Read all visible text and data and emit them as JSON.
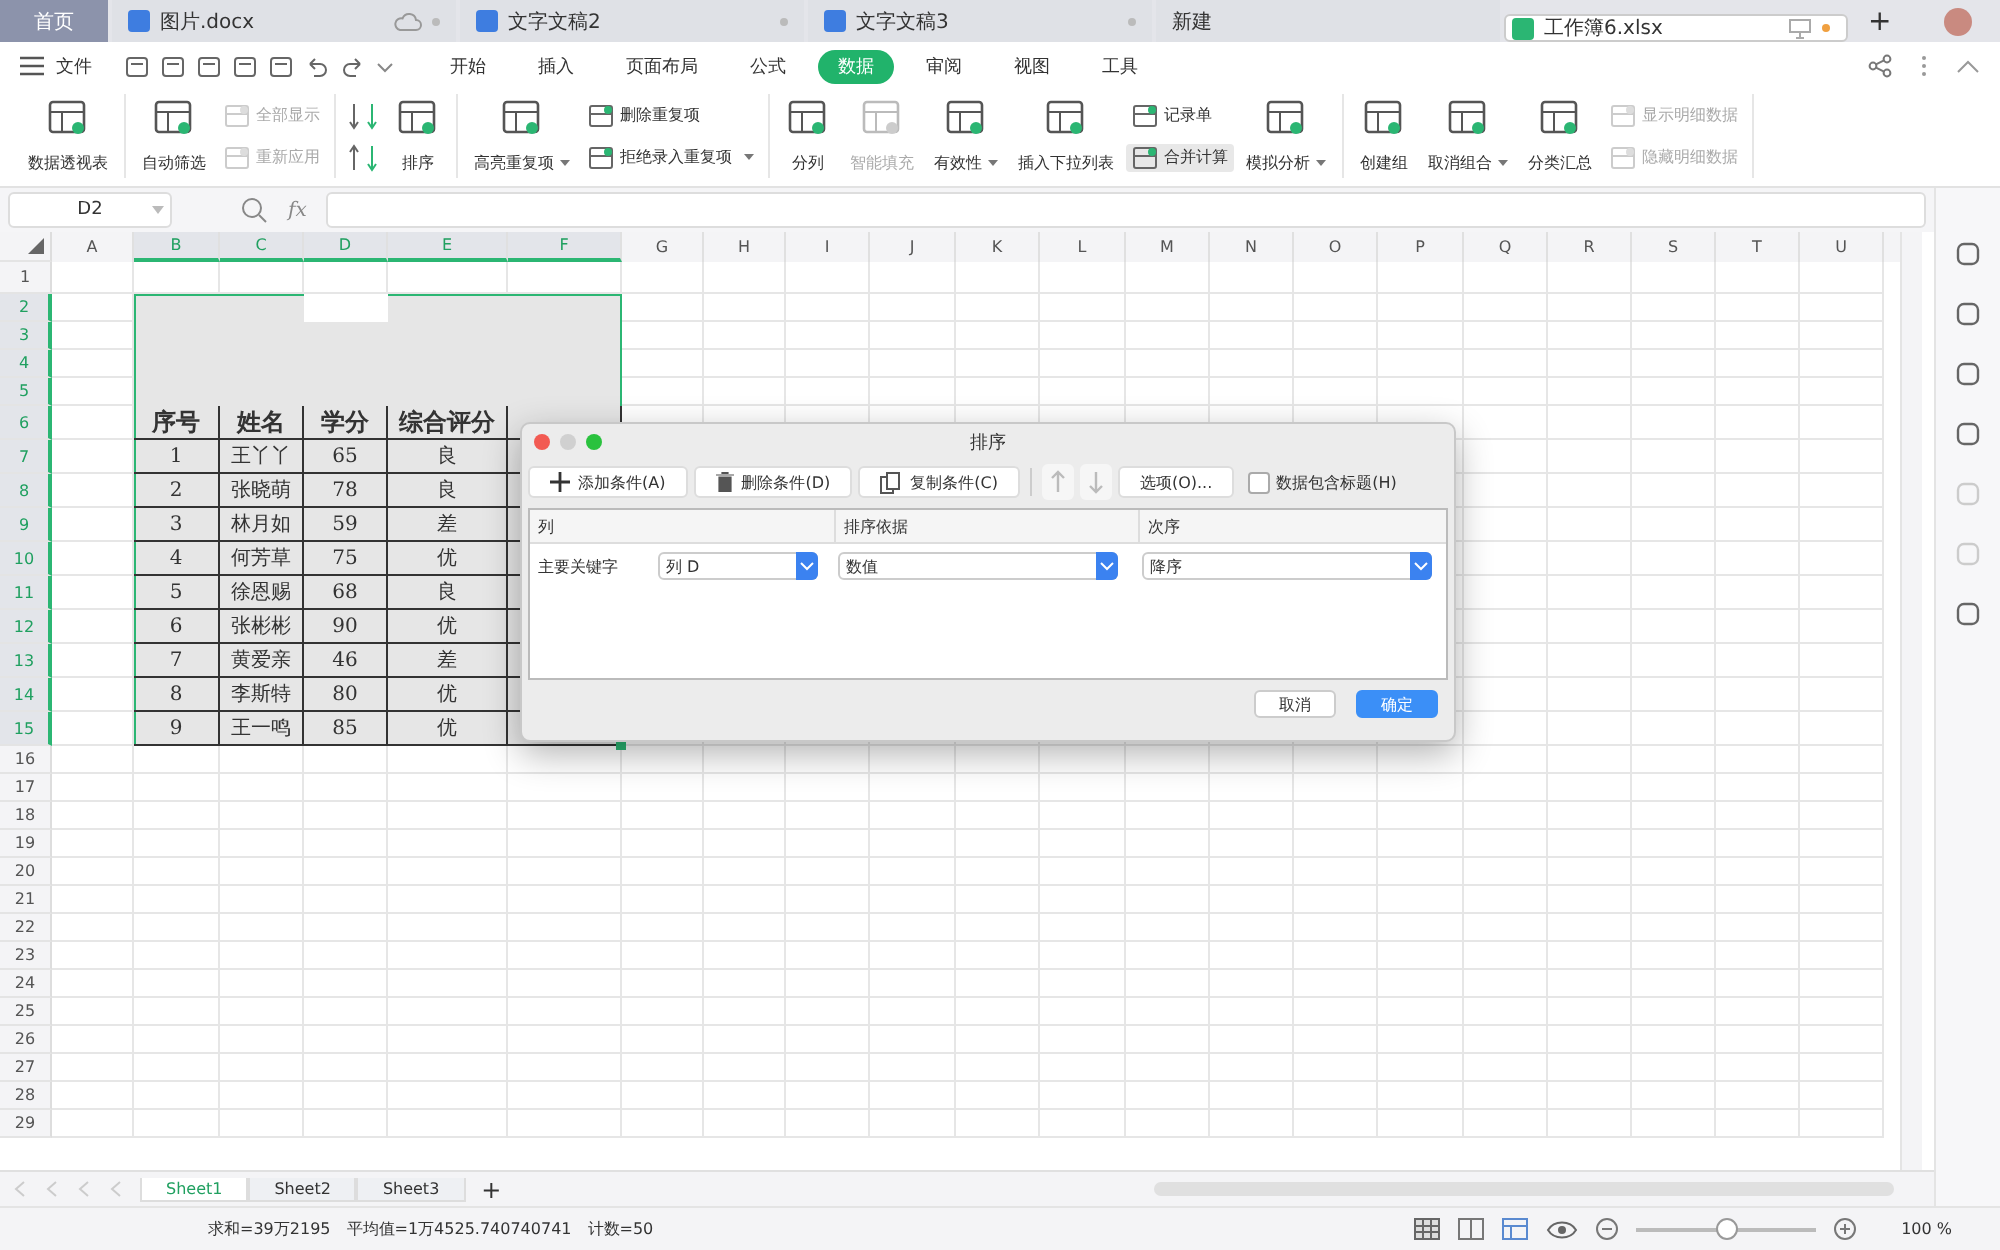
{
  "doc_tabs": [
    {
      "label": "首页",
      "kind": "home",
      "selected": false
    },
    {
      "label": "图片.docx",
      "kind": "doc",
      "selected": false
    },
    {
      "label": "文字文稿2",
      "kind": "doc",
      "selected": false
    },
    {
      "label": "文字文稿3",
      "kind": "doc",
      "selected": false
    },
    {
      "label": "新建",
      "kind": "plain",
      "selected": false
    },
    {
      "label": "工作簿6.xlsx",
      "kind": "sheet",
      "selected": true
    }
  ],
  "new_tab": "+",
  "menu": {
    "file": "文件",
    "tabs": [
      {
        "label": "开始",
        "selected": false
      },
      {
        "label": "插入",
        "selected": false
      },
      {
        "label": "页面布局",
        "selected": false
      },
      {
        "label": "公式",
        "selected": false
      },
      {
        "label": "数据",
        "selected": true
      },
      {
        "label": "审阅",
        "selected": false
      },
      {
        "label": "视图",
        "selected": false
      },
      {
        "label": "工具",
        "selected": false
      }
    ]
  },
  "ribbon": [
    {
      "items": [
        {
          "kind": "large",
          "label": "数据透视表",
          "dropdown": false,
          "disabled": false
        }
      ]
    },
    {
      "items": [
        {
          "kind": "large",
          "label": "自动筛选",
          "dropdown": false,
          "disabled": false
        },
        {
          "kind": "stack",
          "items": [
            {
              "label": "全部显示",
              "disabled": true,
              "hovered": false,
              "dropdown": false
            },
            {
              "label": "重新应用",
              "disabled": true,
              "hovered": false,
              "dropdown": false
            }
          ]
        }
      ]
    },
    {
      "items": [
        {
          "kind": "sort"
        },
        {
          "kind": "large",
          "label": "排序",
          "dropdown": false,
          "disabled": false
        }
      ]
    },
    {
      "items": [
        {
          "kind": "large",
          "label": "高亮重复项",
          "dropdown": true,
          "disabled": false
        },
        {
          "kind": "stack",
          "items": [
            {
              "label": "删除重复项",
              "disabled": false,
              "hovered": false,
              "dropdown": false
            },
            {
              "label": "拒绝录入重复项",
              "disabled": false,
              "hovered": false,
              "dropdown": true
            }
          ]
        }
      ]
    },
    {
      "items": [
        {
          "kind": "large",
          "label": "分列",
          "dropdown": false,
          "disabled": false
        },
        {
          "kind": "large",
          "label": "智能填充",
          "dropdown": false,
          "disabled": true
        },
        {
          "kind": "large",
          "label": "有效性",
          "dropdown": true,
          "disabled": false
        },
        {
          "kind": "large",
          "label": "插入下拉列表",
          "dropdown": false,
          "disabled": false
        },
        {
          "kind": "stack",
          "items": [
            {
              "label": "记录单",
              "disabled": false,
              "hovered": false,
              "dropdown": false
            },
            {
              "label": "合并计算",
              "disabled": false,
              "hovered": true,
              "dropdown": false
            }
          ]
        },
        {
          "kind": "large",
          "label": "模拟分析",
          "dropdown": true,
          "disabled": false
        }
      ]
    },
    {
      "items": [
        {
          "kind": "large",
          "label": "创建组",
          "dropdown": false,
          "disabled": false
        },
        {
          "kind": "large",
          "label": "取消组合",
          "dropdown": true,
          "disabled": false
        },
        {
          "kind": "large",
          "label": "分类汇总",
          "dropdown": false,
          "disabled": false
        },
        {
          "kind": "stack",
          "items": [
            {
              "label": "显示明细数据",
              "disabled": true,
              "hovered": false,
              "dropdown": false
            },
            {
              "label": "隐藏明细数据",
              "disabled": true,
              "hovered": false,
              "dropdown": false
            }
          ]
        }
      ]
    }
  ],
  "formula_bar": {
    "name_box": "D2",
    "fx": "fx"
  },
  "columns": [
    {
      "label": "A",
      "selected": false
    },
    {
      "label": "B",
      "selected": true
    },
    {
      "label": "C",
      "selected": true
    },
    {
      "label": "D",
      "selected": true
    },
    {
      "label": "E",
      "selected": true
    },
    {
      "label": "F",
      "selected": true
    },
    {
      "label": "G",
      "selected": false
    },
    {
      "label": "H",
      "selected": false
    },
    {
      "label": "I",
      "selected": false
    },
    {
      "label": "J",
      "selected": false
    },
    {
      "label": "K",
      "selected": false
    },
    {
      "label": "L",
      "selected": false
    },
    {
      "label": "M",
      "selected": false
    },
    {
      "label": "N",
      "selected": false
    },
    {
      "label": "O",
      "selected": false
    },
    {
      "label": "P",
      "selected": false
    },
    {
      "label": "Q",
      "selected": false
    },
    {
      "label": "R",
      "selected": false
    },
    {
      "label": "S",
      "selected": false
    },
    {
      "label": "T",
      "selected": false
    },
    {
      "label": "U",
      "selected": false
    }
  ],
  "rows": [
    {
      "label": "1",
      "selected": false,
      "kind": "blank"
    },
    {
      "label": "2",
      "selected": true,
      "kind": "blank"
    },
    {
      "label": "3",
      "selected": true,
      "kind": "blank"
    },
    {
      "label": "4",
      "selected": true,
      "kind": "blank"
    },
    {
      "label": "5",
      "selected": true,
      "kind": "blank"
    },
    {
      "label": "6",
      "selected": true,
      "kind": "header",
      "cells": [
        "",
        "序号",
        "姓名",
        "学分",
        "综合评分"
      ]
    },
    {
      "label": "7",
      "selected": true,
      "kind": "data",
      "cells": [
        "",
        "1",
        "王丫丫",
        "65",
        "良"
      ]
    },
    {
      "label": "8",
      "selected": true,
      "kind": "data",
      "cells": [
        "",
        "2",
        "张晓萌",
        "78",
        "良"
      ]
    },
    {
      "label": "9",
      "selected": true,
      "kind": "data",
      "cells": [
        "",
        "3",
        "林月如",
        "59",
        "差"
      ]
    },
    {
      "label": "10",
      "selected": true,
      "kind": "data",
      "cells": [
        "",
        "4",
        "何芳草",
        "75",
        "优"
      ]
    },
    {
      "label": "11",
      "selected": true,
      "kind": "data",
      "cells": [
        "",
        "5",
        "徐恩赐",
        "68",
        "良"
      ]
    },
    {
      "label": "12",
      "selected": true,
      "kind": "data",
      "cells": [
        "",
        "6",
        "张彬彬",
        "90",
        "优"
      ]
    },
    {
      "label": "13",
      "selected": true,
      "kind": "data",
      "cells": [
        "",
        "7",
        "黄爱亲",
        "46",
        "差"
      ]
    },
    {
      "label": "14",
      "selected": true,
      "kind": "data",
      "cells": [
        "",
        "8",
        "李斯特",
        "80",
        "优"
      ]
    },
    {
      "label": "15",
      "selected": true,
      "kind": "data",
      "cells": [
        "",
        "9",
        "王一鸣",
        "85",
        "优"
      ]
    },
    {
      "label": "16",
      "selected": false,
      "kind": "blank"
    },
    {
      "label": "17",
      "selected": false,
      "kind": "blank"
    },
    {
      "label": "18",
      "selected": false,
      "kind": "blank"
    },
    {
      "label": "19",
      "selected": false,
      "kind": "blank"
    },
    {
      "label": "20",
      "selected": false,
      "kind": "blank"
    },
    {
      "label": "21",
      "selected": false,
      "kind": "blank"
    },
    {
      "label": "22",
      "selected": false,
      "kind": "blank"
    },
    {
      "label": "23",
      "selected": false,
      "kind": "blank"
    },
    {
      "label": "24",
      "selected": false,
      "kind": "blank"
    },
    {
      "label": "25",
      "selected": false,
      "kind": "blank"
    },
    {
      "label": "26",
      "selected": false,
      "kind": "blank"
    },
    {
      "label": "27",
      "selected": false,
      "kind": "blank"
    },
    {
      "label": "28",
      "selected": false,
      "kind": "blank"
    },
    {
      "label": "29",
      "selected": false,
      "kind": "blank"
    }
  ],
  "dialog": {
    "title": "排序",
    "toolbar": [
      {
        "label": "添加条件(A)"
      },
      {
        "label": "删除条件(D)"
      },
      {
        "label": "复制条件(C)"
      }
    ],
    "options": "选项(O)...",
    "header_checkbox": {
      "label": "数据包含标题(H)",
      "checked": false
    },
    "headers": [
      "列",
      "排序依据",
      "次序"
    ],
    "conditions": [
      {
        "label": "主要关键字",
        "column": "列 D",
        "basis": "数值",
        "order": "降序"
      }
    ],
    "buttons": [
      {
        "label": "取消",
        "primary": false
      },
      {
        "label": "确定",
        "primary": true
      }
    ]
  },
  "sheet_tabs": [
    {
      "label": "Sheet1",
      "selected": true
    },
    {
      "label": "Sheet2",
      "selected": false
    },
    {
      "label": "Sheet3",
      "selected": false
    }
  ],
  "add_sheet": "+",
  "status": {
    "stats": [
      "求和=39万2195",
      "平均值=1万4525.740740741",
      "计数=50"
    ],
    "zoom": "100 %",
    "level": 0.5
  }
}
